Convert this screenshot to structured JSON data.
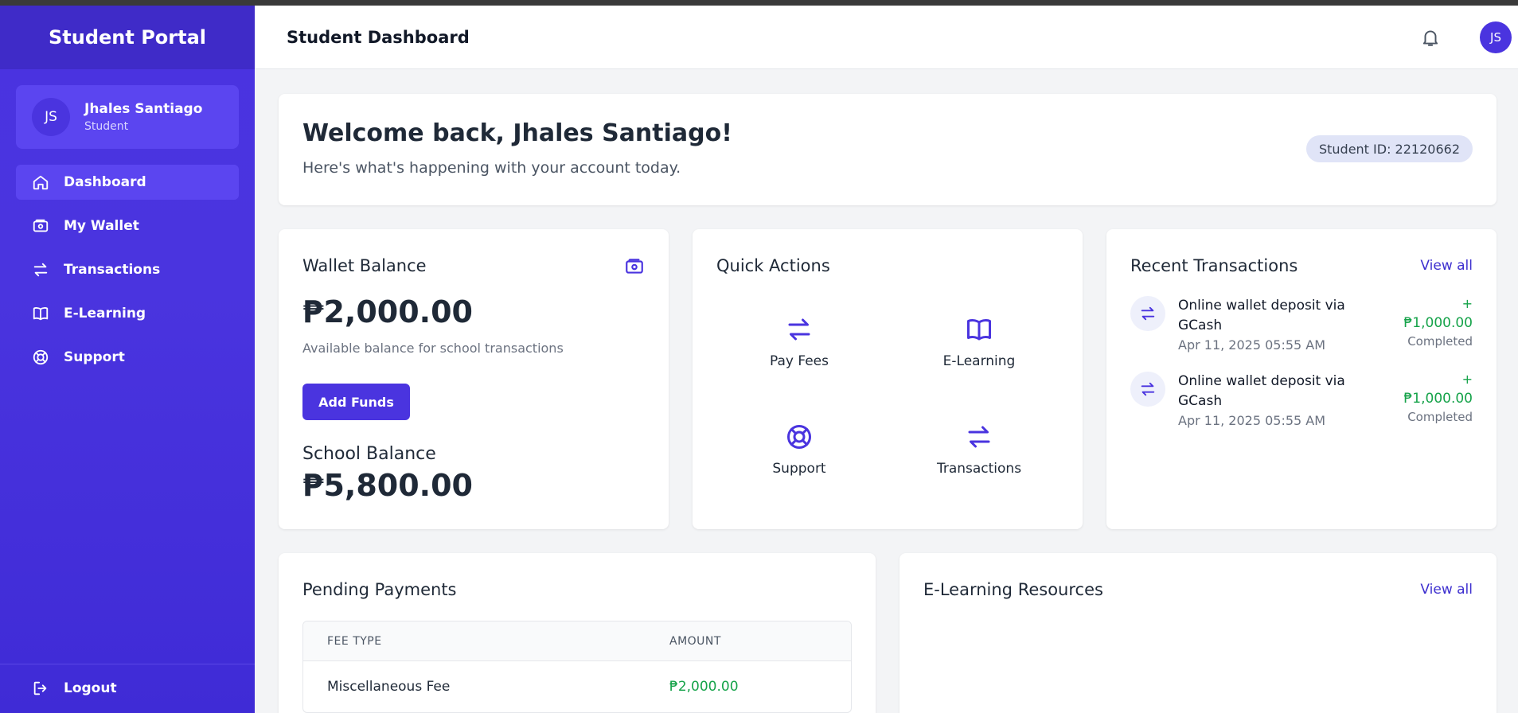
{
  "sidebar": {
    "brand": "Student Portal",
    "user": {
      "initials": "JS",
      "name": "Jhales Santiago",
      "role": "Student"
    },
    "items": [
      {
        "label": "Dashboard",
        "icon": "home-icon"
      },
      {
        "label": "My Wallet",
        "icon": "wallet-icon"
      },
      {
        "label": "Transactions",
        "icon": "arrows-icon"
      },
      {
        "label": "E-Learning",
        "icon": "book-icon"
      },
      {
        "label": "Support",
        "icon": "lifebuoy-icon"
      }
    ],
    "logout": "Logout"
  },
  "header": {
    "title": "Student Dashboard",
    "avatar": "JS"
  },
  "welcome": {
    "heading": "Welcome back, Jhales Santiago!",
    "subtext": "Here's what's happening with your account today.",
    "student_id": "Student ID: 22120662"
  },
  "wallet": {
    "title": "Wallet Balance",
    "balance": "₱2,000.00",
    "description": "Available balance for school transactions",
    "add_funds": "Add Funds",
    "school_label": "School Balance",
    "school_balance": "₱5,800.00"
  },
  "quick_actions": {
    "title": "Quick Actions",
    "items": [
      {
        "label": "Pay Fees",
        "icon": "arrows-icon"
      },
      {
        "label": "E-Learning",
        "icon": "book-icon"
      },
      {
        "label": "Support",
        "icon": "lifebuoy-icon"
      },
      {
        "label": "Transactions",
        "icon": "arrows-icon"
      }
    ]
  },
  "recent": {
    "title": "Recent Transactions",
    "view_all": "View all",
    "items": [
      {
        "desc": "Online wallet deposit via GCash",
        "date": "Apr 11, 2025 05:55 AM",
        "sign": "+",
        "amount": "₱1,000.00",
        "status": "Completed"
      },
      {
        "desc": "Online wallet deposit via GCash",
        "date": "Apr 11, 2025 05:55 AM",
        "sign": "+",
        "amount": "₱1,000.00",
        "status": "Completed"
      }
    ]
  },
  "pending": {
    "title": "Pending Payments",
    "columns": [
      "FEE TYPE",
      "AMOUNT"
    ],
    "rows": [
      {
        "fee": "Miscellaneous Fee",
        "amount": "₱2,000.00"
      }
    ]
  },
  "elearning": {
    "title": "E-Learning Resources",
    "view_all": "View all"
  },
  "colors": {
    "primary": "#4a34df",
    "green": "#16a34a",
    "link": "#3d2fcf"
  }
}
